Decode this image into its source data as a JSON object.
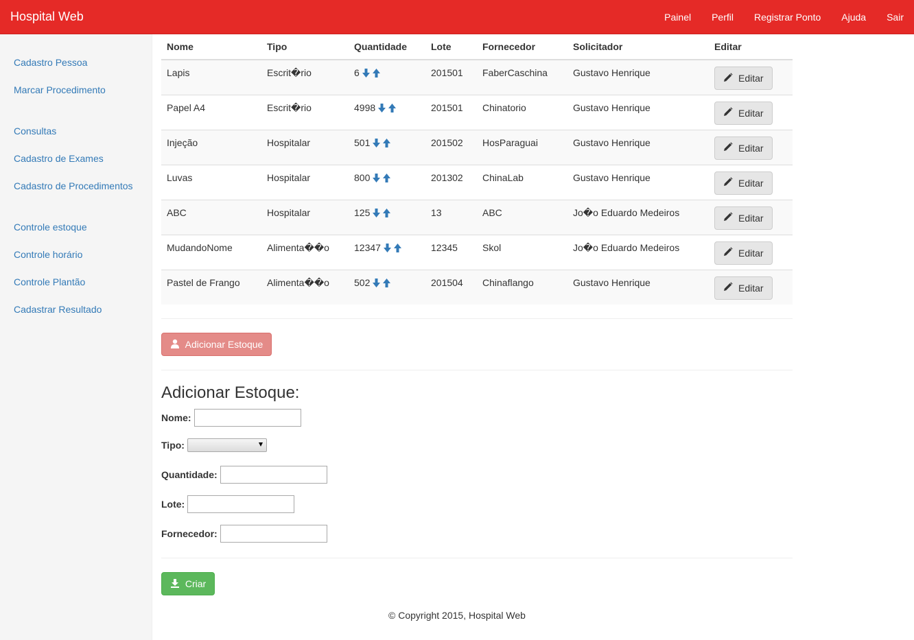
{
  "app": {
    "brand": "Hospital Web"
  },
  "nav": {
    "items": [
      {
        "label": "Painel"
      },
      {
        "label": "Perfil"
      },
      {
        "label": "Registrar Ponto"
      },
      {
        "label": "Ajuda"
      },
      {
        "label": "Sair"
      }
    ]
  },
  "sidebar": {
    "items": [
      {
        "label": "Cadastro Pessoa"
      },
      {
        "label": "Marcar Procedimento"
      },
      {
        "label": "Consultas"
      },
      {
        "label": "Cadastro de Exames"
      },
      {
        "label": "Cadastro de Procedimentos"
      },
      {
        "label": "Controle estoque"
      },
      {
        "label": "Controle horário"
      },
      {
        "label": "Controle Plantão"
      },
      {
        "label": "Cadastrar Resultado"
      }
    ]
  },
  "table": {
    "headers": [
      "Nome",
      "Tipo",
      "Quantidade",
      "Lote",
      "Fornecedor",
      "Solicitador",
      "Editar"
    ],
    "edit_label": "Editar",
    "rows": [
      {
        "nome": "Lapis",
        "tipo": "Escrit�rio",
        "quantidade": "6",
        "lote": "201501",
        "fornecedor": "FaberCaschina",
        "solicitador": "Gustavo Henrique"
      },
      {
        "nome": "Papel A4",
        "tipo": "Escrit�rio",
        "quantidade": "4998",
        "lote": "201501",
        "fornecedor": "Chinatorio",
        "solicitador": "Gustavo Henrique"
      },
      {
        "nome": "Injeção",
        "tipo": "Hospitalar",
        "quantidade": "501",
        "lote": "201502",
        "fornecedor": "HosParaguai",
        "solicitador": "Gustavo Henrique"
      },
      {
        "nome": "Luvas",
        "tipo": "Hospitalar",
        "quantidade": "800",
        "lote": "201302",
        "fornecedor": "ChinaLab",
        "solicitador": "Gustavo Henrique"
      },
      {
        "nome": "ABC",
        "tipo": "Hospitalar",
        "quantidade": "125",
        "lote": "13",
        "fornecedor": "ABC",
        "solicitador": "Jo�o Eduardo Medeiros"
      },
      {
        "nome": "MudandoNome",
        "tipo": "Alimenta��o",
        "quantidade": "12347",
        "lote": "12345",
        "fornecedor": "Skol",
        "solicitador": "Jo�o Eduardo Medeiros"
      },
      {
        "nome": "Pastel de Frango",
        "tipo": "Alimenta��o",
        "quantidade": "502",
        "lote": "201504",
        "fornecedor": "Chinaflango",
        "solicitador": "Gustavo Henrique"
      }
    ]
  },
  "actions": {
    "add_stock_label": "Adicionar Estoque"
  },
  "form": {
    "title": "Adicionar Estoque:",
    "nome_label": "Nome:",
    "nome_value": "",
    "tipo_label": "Tipo:",
    "tipo_value": "",
    "quantidade_label": "Quantidade:",
    "quantidade_value": "",
    "lote_label": "Lote:",
    "lote_value": "",
    "fornecedor_label": "Fornecedor:",
    "fornecedor_value": "",
    "submit_label": "Criar"
  },
  "footer": {
    "copyright": "© Copyright 2015, Hospital Web"
  },
  "colors": {
    "navbar": "#e52a27",
    "link": "#337ab7",
    "add_button": "#e48b88",
    "submit_button": "#5cb85c"
  },
  "icons": {
    "edit": "pencil-icon",
    "decrease": "arrow-down-icon",
    "increase": "arrow-up-icon",
    "add": "user-icon",
    "submit": "download-icon"
  }
}
